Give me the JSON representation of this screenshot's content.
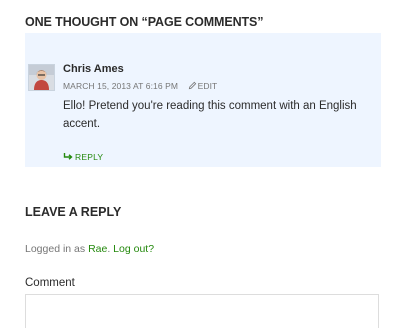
{
  "comments": {
    "title": "One thought on “Page Comments”",
    "items": [
      {
        "author": "Chris Ames",
        "date": "March 15, 2013 at 6:16 pm",
        "edit_label": "Edit",
        "text": "Ello! Pretend you're reading this comment with an English accent.",
        "reply_label": "Reply",
        "avatar_icon": "user-avatar"
      }
    ],
    "background_color": "#eef5ff"
  },
  "reply_form": {
    "title": "Leave a Reply",
    "logged_in_prefix": "Logged in as ",
    "user_name": "Rae",
    "separator": ". ",
    "logout_label": "Log out?",
    "comment_label": "Comment",
    "comment_value": ""
  },
  "colors": {
    "link": "#24890d",
    "text": "#2b2b2b",
    "muted": "#767676"
  }
}
